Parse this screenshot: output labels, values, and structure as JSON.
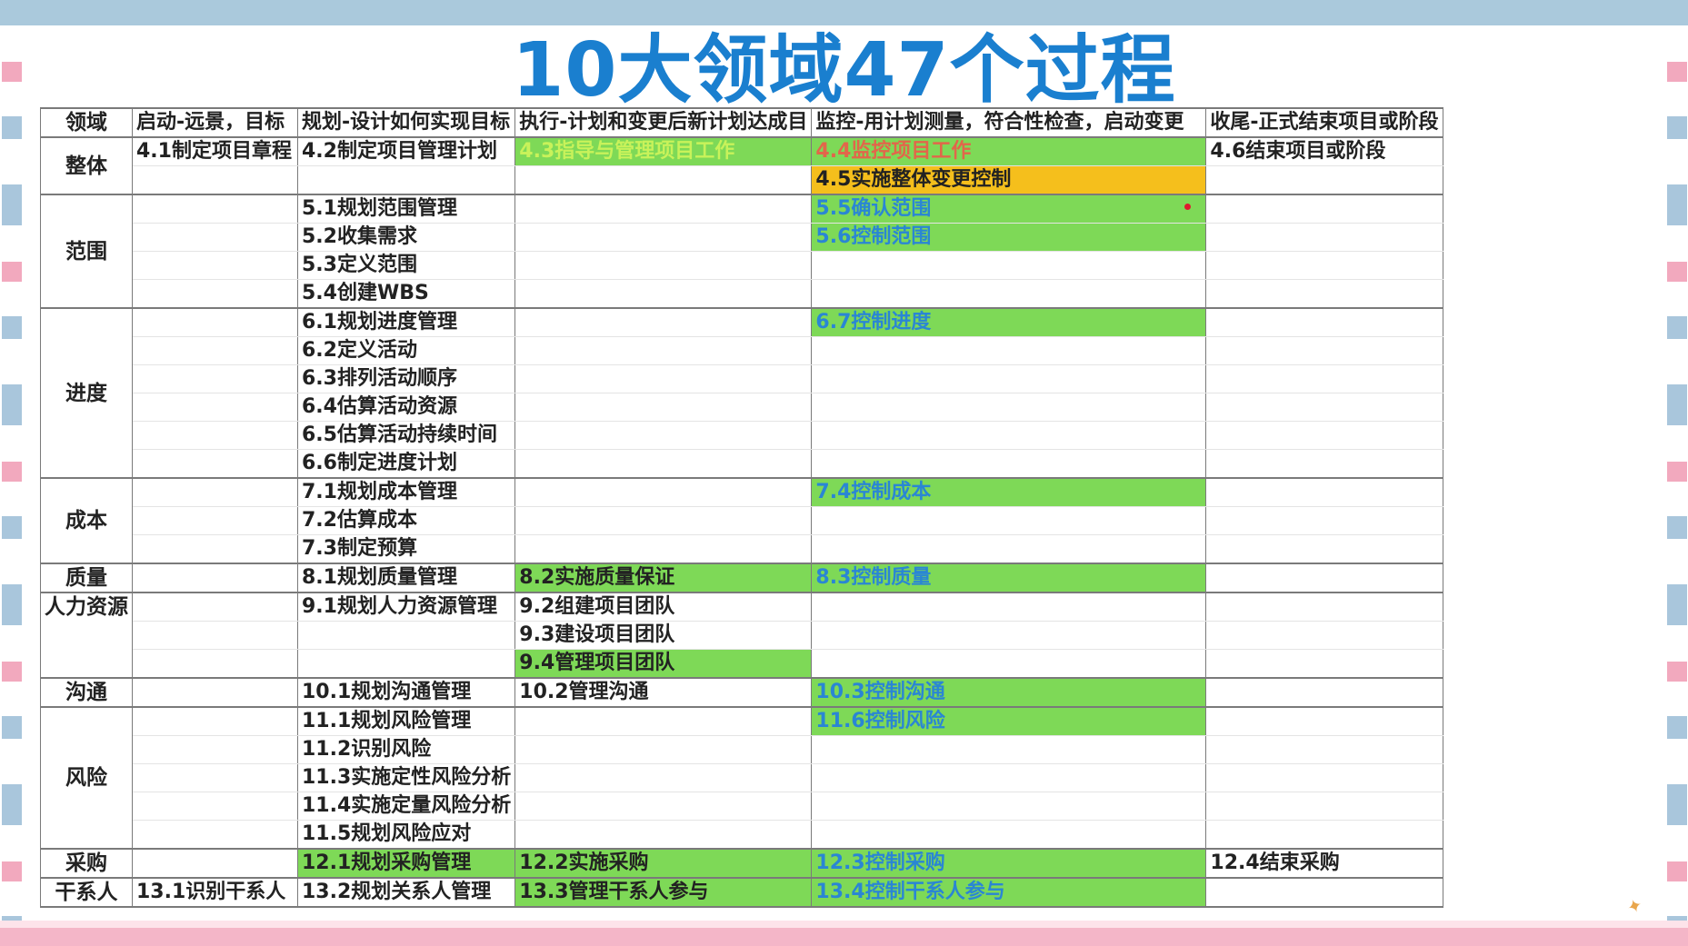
{
  "title": "10大领域47个过程",
  "table": {
    "headers": {
      "area": "领域",
      "initiating": "启动-远景，目标",
      "planning": "规划-设计如何实现目标",
      "executing": "执行-计划和变更后新计划达成目",
      "monitoring": "监控-用计划测量，符合性检查，启动变更",
      "closing": "收尾-正式结束项目或阶段"
    },
    "areas": {
      "integration": "整体",
      "scope": "范围",
      "schedule": "进度",
      "cost": "成本",
      "quality": "质量",
      "hr": "人力资源",
      "comm": "沟通",
      "risk": "风险",
      "procure": "采购",
      "stake": "干系人"
    },
    "cells": {
      "p4_1": "4.1制定项目章程",
      "p4_2": "4.2制定项目管理计划",
      "p4_3": "4.3指导与管理项目工作",
      "p4_4": "4.4监控项目工作",
      "p4_5": "4.5实施整体变更控制",
      "p4_6": "4.6结束项目或阶段",
      "p5_1": "5.1规划范围管理",
      "p5_2": "5.2收集需求",
      "p5_3": "5.3定义范围",
      "p5_4": "5.4创建WBS",
      "p5_5": "5.5确认范围",
      "p5_6": "5.6控制范围",
      "p6_1": "6.1规划进度管理",
      "p6_2": "6.2定义活动",
      "p6_3": "6.3排列活动顺序",
      "p6_4": "6.4估算活动资源",
      "p6_5": "6.5估算活动持续时间",
      "p6_6": "6.6制定进度计划",
      "p6_7": "6.7控制进度",
      "p7_1": "7.1规划成本管理",
      "p7_2": "7.2估算成本",
      "p7_3": "7.3制定预算",
      "p7_4": "7.4控制成本",
      "p8_1": "8.1规划质量管理",
      "p8_2": "8.2实施质量保证",
      "p8_3": "8.3控制质量",
      "p9_1": "9.1规划人力资源管理",
      "p9_2": "9.2组建项目团队",
      "p9_3": "9.3建设项目团队",
      "p9_4": "9.4管理项目团队",
      "p10_1": "10.1规划沟通管理",
      "p10_2": "10.2管理沟通",
      "p10_3": "10.3控制沟通",
      "p11_1": "11.1规划风险管理",
      "p11_2": "11.2识别风险",
      "p11_3": "11.3实施定性风险分析",
      "p11_4": "11.4实施定量风险分析",
      "p11_5": "11.5规划风险应对",
      "p11_6": "11.6控制风险",
      "p12_1": "12.1规划采购管理",
      "p12_2": "12.2实施采购",
      "p12_3": "12.3控制采购",
      "p12_4": "12.4结束采购",
      "p13_1": "13.1识别干系人",
      "p13_2": "13.2规划关系人管理",
      "p13_3": "13.3管理干系人参与",
      "p13_4": "13.4控制干系人参与"
    }
  },
  "colors": {
    "title": "#1a7fcf",
    "highlight_green": "#7ed957",
    "highlight_orange": "#f5bf1c",
    "text_light_green": "#c8f25a",
    "text_orange": "#e2664a",
    "text_blue": "#2a86d4"
  }
}
